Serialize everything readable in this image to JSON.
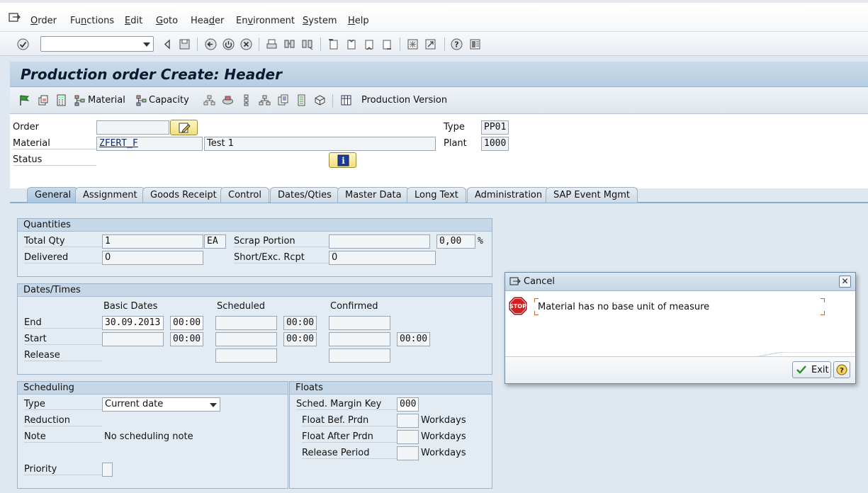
{
  "menu": {
    "items": [
      {
        "label": "Order",
        "underline": "O"
      },
      {
        "label": "Functions",
        "underline": "n"
      },
      {
        "label": "Edit",
        "underline": "E"
      },
      {
        "label": "Goto",
        "underline": "G"
      },
      {
        "label": "Header",
        "underline": "d"
      },
      {
        "label": "Environment",
        "underline": "v"
      },
      {
        "label": "System",
        "underline": "S"
      },
      {
        "label": "Help",
        "underline": "H"
      }
    ]
  },
  "command_field": {
    "value": ""
  },
  "title": "Production order Create: Header",
  "app_toolbar": {
    "material_label": "Material",
    "capacity_label": "Capacity",
    "production_version_label": "Production Version"
  },
  "header": {
    "order_label": "Order",
    "order_value": "",
    "material_label": "Material",
    "material_value": "ZFERT_F",
    "material_desc": "Test 1",
    "status_label": "Status",
    "type_label": "Type",
    "type_value": "PP01",
    "plant_label": "Plant",
    "plant_value": "1000"
  },
  "tabs": [
    {
      "label": "General",
      "active": true
    },
    {
      "label": "Assignment"
    },
    {
      "label": "Goods Receipt"
    },
    {
      "label": "Control"
    },
    {
      "label": "Dates/Qties"
    },
    {
      "label": "Master Data"
    },
    {
      "label": "Long Text"
    },
    {
      "label": "Administration"
    },
    {
      "label": "SAP Event Mgmt"
    }
  ],
  "quantities": {
    "title": "Quantities",
    "total_qty_label": "Total Qty",
    "total_qty_value": "1",
    "unit": "EA",
    "scrap_label": "Scrap Portion",
    "scrap_value": "",
    "scrap_pct": "0,00",
    "pct_sign": "%",
    "delivered_label": "Delivered",
    "delivered_value": "0",
    "short_label": "Short/Exc. Rcpt",
    "short_value": "0"
  },
  "dates": {
    "title": "Dates/Times",
    "col_basic": "Basic Dates",
    "col_scheduled": "Scheduled",
    "col_confirmed": "Confirmed",
    "end_label": "End",
    "end_basic_date": "30.09.2013",
    "end_basic_time": "00:00",
    "end_sched_time": "00:00",
    "start_label": "Start",
    "start_basic_time": "00:00",
    "start_sched_time": "00:00",
    "start_conf_time": "00:00",
    "release_label": "Release"
  },
  "scheduling": {
    "title": "Scheduling",
    "type_label": "Type",
    "type_value": "Current date",
    "reduction_label": "Reduction",
    "note_label": "Note",
    "note_value": "No scheduling note",
    "priority_label": "Priority"
  },
  "floats": {
    "title": "Floats",
    "margin_key_label": "Sched. Margin Key",
    "margin_key_value": "000",
    "float_bef_label": "Float Bef. Prdn",
    "float_after_label": "Float After Prdn",
    "release_period_label": "Release Period",
    "unit": "Workdays"
  },
  "dialog": {
    "title": "Cancel",
    "message": "Material has no base unit of measure",
    "stop_text": "STOP",
    "exit_label": "Exit",
    "close_glyph": "✕"
  },
  "colors": {
    "accent": "#b6cde0",
    "stop_red": "#d21f1f",
    "ok_green": "#2c8a2c"
  }
}
